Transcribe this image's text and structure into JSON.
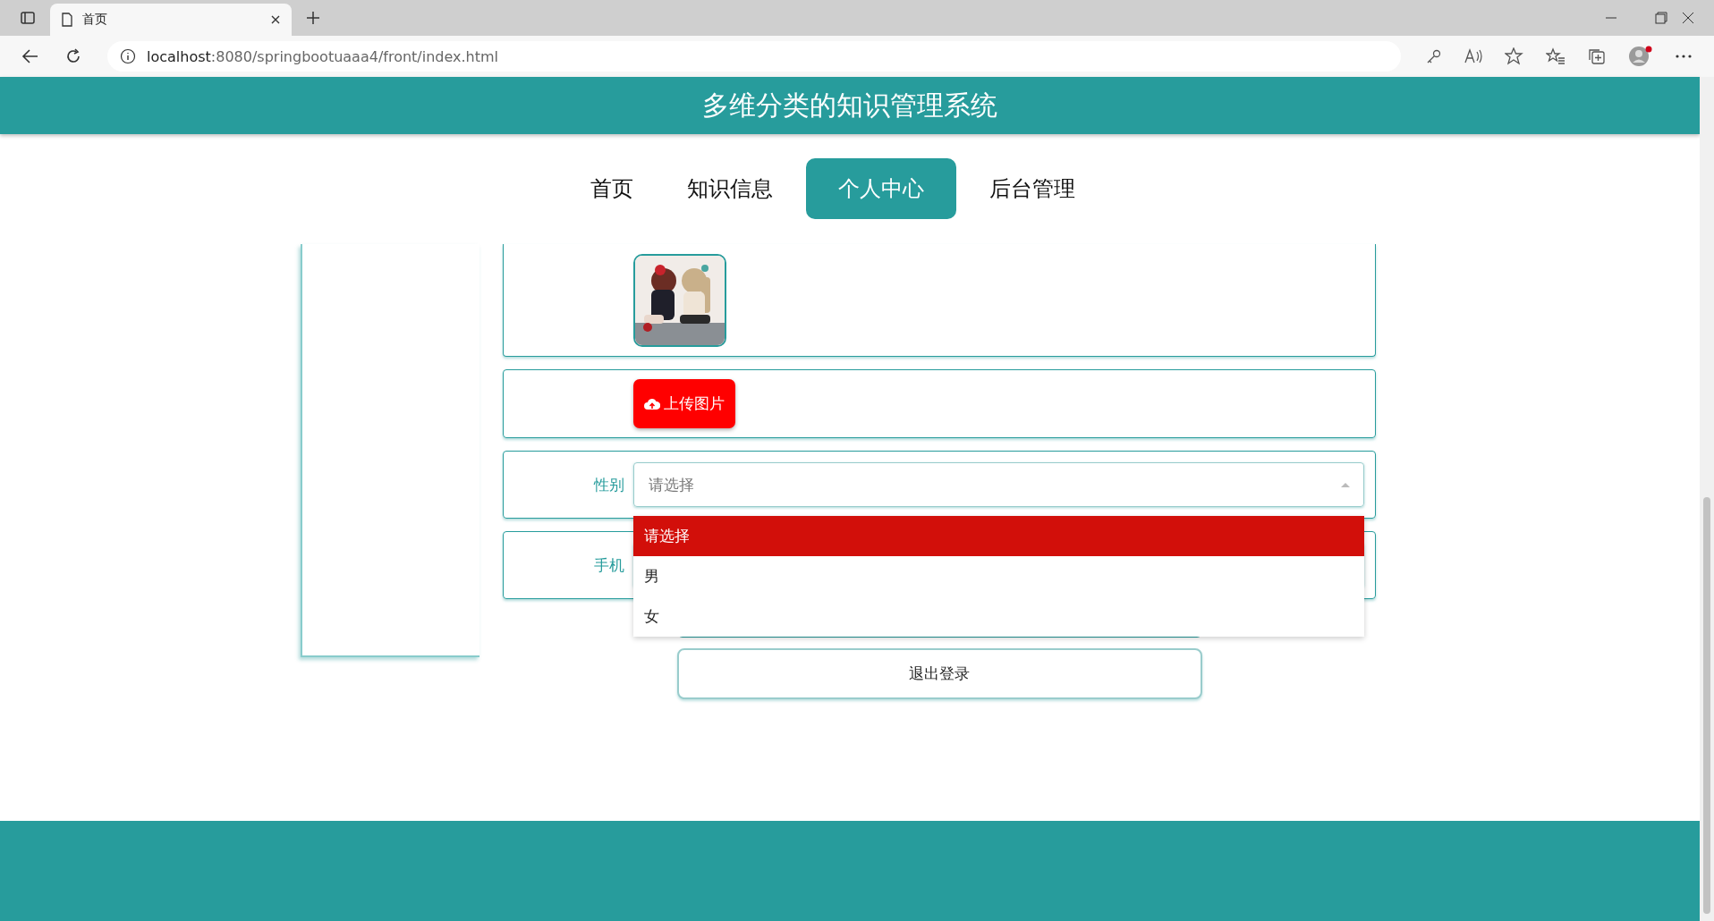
{
  "browser": {
    "tab_title": "首页",
    "url_host": "localhost",
    "url_rest": ":8080/springbootuaaa4/front/index.html"
  },
  "header": {
    "title": "多维分类的知识管理系统"
  },
  "nav": [
    {
      "label": "首页",
      "selected": false
    },
    {
      "label": "知识信息",
      "selected": false
    },
    {
      "label": "个人中心",
      "selected": true
    },
    {
      "label": "后台管理",
      "selected": false
    }
  ],
  "form": {
    "upload_button": "上传图片",
    "gender": {
      "label": "性别",
      "placeholder": "请选择",
      "expanded": true,
      "options": [
        {
          "label": "请选择",
          "selected": true
        },
        {
          "label": "男",
          "selected": false
        },
        {
          "label": "女",
          "selected": false
        }
      ]
    },
    "phone": {
      "label": "手机"
    },
    "logout_button": "退出登录"
  }
}
